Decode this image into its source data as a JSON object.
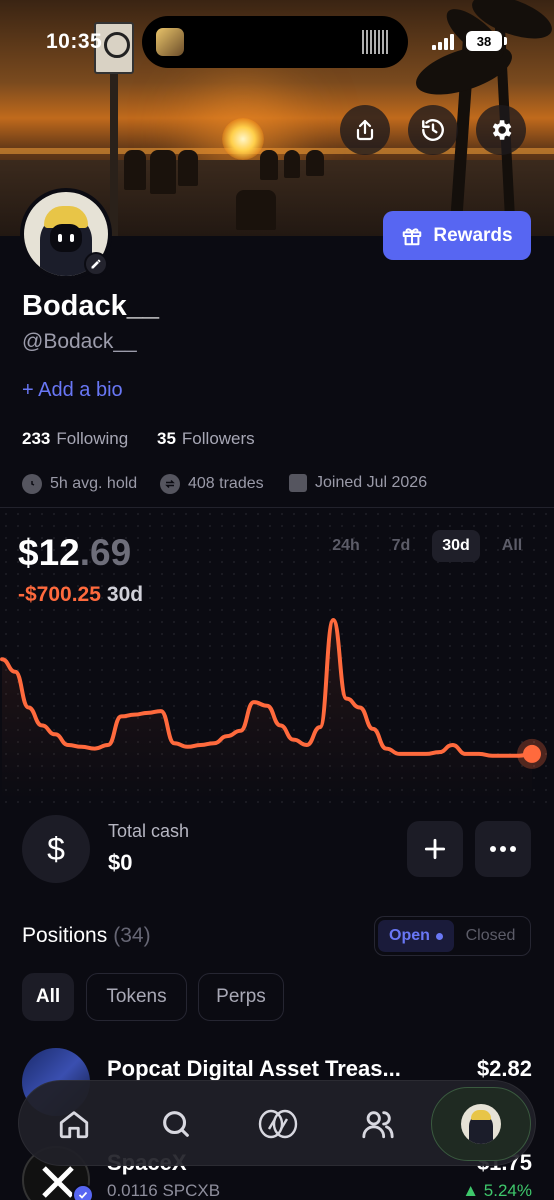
{
  "status_bar": {
    "time": "10:35",
    "battery": "38"
  },
  "profile": {
    "display_name": "Bodack__",
    "handle": "@Bodack__",
    "add_bio": "+ Add a bio",
    "following_count": "233",
    "following_label": "Following",
    "followers_count": "35",
    "followers_label": "Followers",
    "avg_hold": "5h avg. hold",
    "trades": "408 trades",
    "joined": "Joined Jul 2026"
  },
  "rewards_label": "Rewards",
  "portfolio": {
    "balance_whole": "$12",
    "balance_decimal": ".69",
    "change": "-$700.25",
    "change_period": "30d",
    "timeframes": [
      "24h",
      "7d",
      "30d",
      "All"
    ],
    "active_timeframe": "30d",
    "line_color": "#ff6a3d"
  },
  "chart_data": {
    "type": "line",
    "series": [
      {
        "values": [
          62,
          55,
          35,
          25,
          20,
          14,
          13,
          12,
          14,
          30,
          31,
          32,
          33,
          15,
          13,
          14,
          15,
          19,
          22,
          38,
          36,
          25,
          17,
          14,
          24,
          84,
          40,
          35,
          23,
          12,
          9,
          9,
          9,
          10,
          14,
          9,
          9,
          8,
          8,
          8,
          9
        ]
      }
    ],
    "xlabel": "",
    "ylabel": ""
  },
  "cash": {
    "label": "Total cash",
    "value": "$0"
  },
  "positions": {
    "title": "Positions",
    "count": "(34)",
    "open_label": "Open",
    "closed_label": "Closed",
    "filters": [
      "All",
      "Tokens",
      "Perps"
    ],
    "items": [
      {
        "name": "Popcat Digital Asset Treas...",
        "value": "$2.82"
      },
      {
        "name": "SpaceX",
        "sub": "0.0116 SPCXB",
        "value": "$1.75",
        "pct": "▲ 5.24%"
      }
    ]
  },
  "colors": {
    "accent": "#5766f2",
    "negative": "#ff6a3d",
    "positive": "#3ec76b",
    "background": "#0b0b12"
  },
  "nav": {
    "items": [
      "home-icon",
      "search-icon",
      "trade-icon",
      "social-icon",
      "profile-avatar"
    ]
  }
}
